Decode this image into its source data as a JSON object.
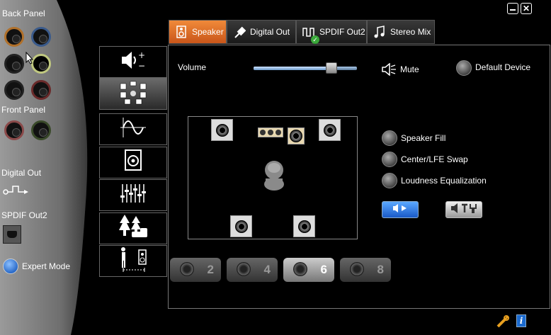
{
  "window": {
    "minimize_icon": "minimize-icon",
    "close_icon": "close-icon"
  },
  "sidebar": {
    "back_panel_label": "Back Panel",
    "front_panel_label": "Front Panel",
    "digital_out_label": "Digital Out",
    "spdif_out2_label": "SPDIF Out2",
    "expert_mode_label": "Expert Mode"
  },
  "tabs": [
    {
      "label": "Speaker",
      "icon": "speaker-icon",
      "active": true
    },
    {
      "label": "Digital Out",
      "icon": "plug-icon",
      "active": false
    },
    {
      "label": "SPDIF Out2",
      "icon": "digital-signal-icon",
      "active": false
    },
    {
      "label": "Stereo Mix",
      "icon": "music-note-icon",
      "active": false
    }
  ],
  "main": {
    "volume_label": "Volume",
    "volume_level": 0.75,
    "mute_label": "Mute",
    "default_device_label": "Default Device",
    "options": [
      {
        "label": "Speaker Fill"
      },
      {
        "label": "Center/LFE Swap"
      },
      {
        "label": "Loudness Equalization"
      }
    ],
    "channels": [
      "2",
      "4",
      "6",
      "8"
    ],
    "selected_channel": "6"
  },
  "colors": {
    "active_tab": "#e0742a",
    "accent_blue": "#2a7fd8"
  }
}
